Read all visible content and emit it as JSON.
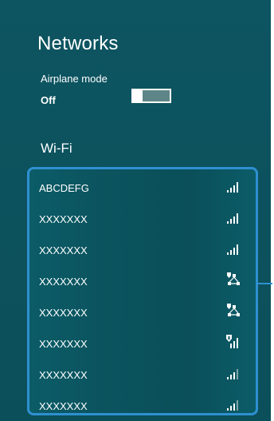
{
  "panel": {
    "title": "Networks",
    "airplane": {
      "label": "Airplane mode",
      "state": "Off"
    },
    "wifi_title": "Wi-Fi",
    "networks": [
      {
        "name": "ABCDEFG",
        "icon": "signal-4-bars-icon"
      },
      {
        "name": "XXXXXXX",
        "icon": "signal-4-bars-icon"
      },
      {
        "name": "XXXXXXX",
        "icon": "signal-4-bars-icon"
      },
      {
        "name": "XXXXXXX",
        "icon": "shielded-network-icon"
      },
      {
        "name": "XXXXXXX",
        "icon": "shielded-network-icon"
      },
      {
        "name": "XXXXXXX",
        "icon": "shielded-signal-icon"
      },
      {
        "name": "XXXXXXX",
        "icon": "signal-3-bars-icon"
      },
      {
        "name": "XXXXXXX",
        "icon": "signal-3-bars-icon"
      }
    ]
  },
  "colors": {
    "panel_bg": "#0d5561",
    "highlight_border": "#2f90d1",
    "text": "#ffffff"
  }
}
